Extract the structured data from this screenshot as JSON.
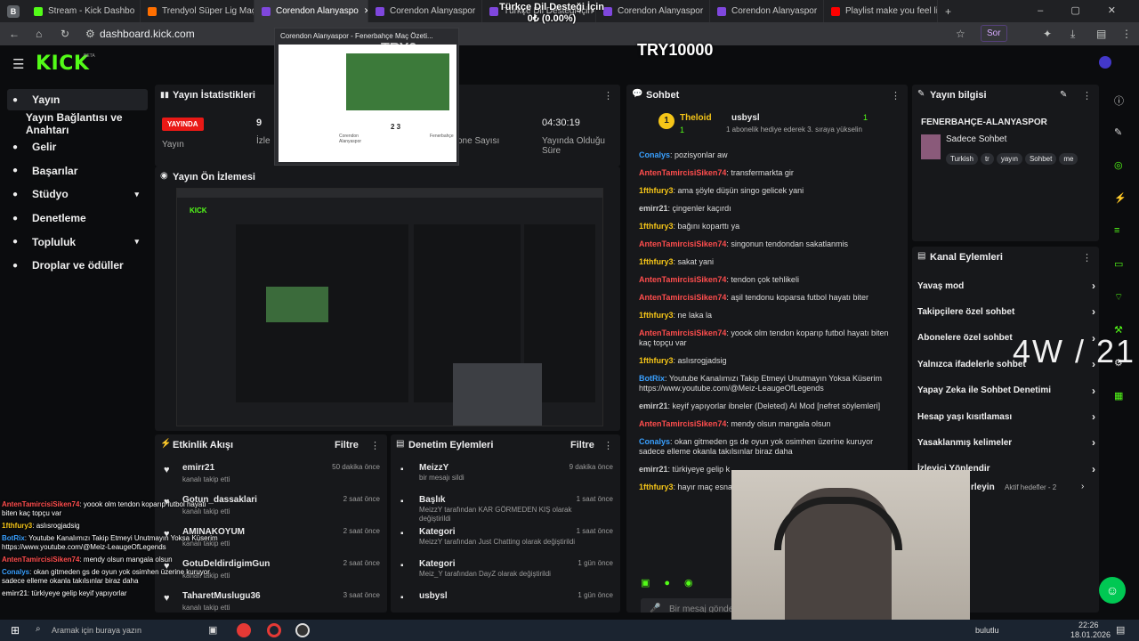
{
  "browser": {
    "tabs": [
      {
        "label": "Stream - Kick Dashbo",
        "color": "#53fc18",
        "active": false
      },
      {
        "label": "Trendyol Süper Lig Maç",
        "color": "#ff6f00",
        "active": false
      },
      {
        "label": "Corendon Alanyaspo",
        "color": "#7f47dd",
        "active": true
      },
      {
        "label": "Corendon Alanyaspor",
        "color": "#7f47dd",
        "active": false
      },
      {
        "label": "Türkçe Dil Desteği İçin",
        "color": "#7f47dd",
        "active": false
      },
      {
        "label": "Corendon Alanyaspor",
        "color": "#7f47dd",
        "active": false
      },
      {
        "label": "Corendon Alanyaspor",
        "color": "#7f47dd",
        "active": false
      },
      {
        "label": "Playlist make you feel lik",
        "color": "#ff0000",
        "active": false
      }
    ],
    "url": "dashboard.kick.com",
    "sor_label": "Sor"
  },
  "tab_preview": {
    "title": "Corendon Alanyaspor - Fenerbahçe Maç Özeti...",
    "score": "2 3",
    "team_left": "Corendon Alanyaspor",
    "team_right": "Fenerbahçe"
  },
  "overlay": {
    "goal_title": "Türkçe Dil Desteği İçin",
    "goal_value": "0₺ (0.00%)",
    "try0": "TRY0",
    "try10000": "TRY10000",
    "side_counter": "4W / 21"
  },
  "kick": {
    "logo": "KICK",
    "beta": "BETA",
    "sidebar": [
      {
        "label": "Yayın",
        "icon": "signal-icon",
        "active": true,
        "expand": false
      },
      {
        "label": "Yayın Bağlantısı ve Anahtarı",
        "icon": "",
        "active": false,
        "expand": false
      },
      {
        "label": "Gelir",
        "icon": "dollar-icon",
        "active": false,
        "expand": false
      },
      {
        "label": "Başarılar",
        "icon": "trophy-icon",
        "active": false,
        "expand": false
      },
      {
        "label": "Stüdyo",
        "icon": "video-icon",
        "active": false,
        "expand": true
      },
      {
        "label": "Denetleme",
        "icon": "wrench-icon",
        "active": false,
        "expand": false
      },
      {
        "label": "Topluluk",
        "icon": "users-icon",
        "active": false,
        "expand": true
      },
      {
        "label": "Droplar ve ödüller",
        "icon": "gift-icon",
        "active": false,
        "expand": false
      }
    ],
    "stats": {
      "title": "Yayın İstatistikleri",
      "live_badge": "YAYINDA",
      "live_sub": "Yayın",
      "viewers_value": "9",
      "viewers_label": "İzle",
      "subs_label": "one Sayısı",
      "uptime_value": "04:30:19",
      "uptime_label": "Yayında Olduğu Süre"
    },
    "preview_title": "Yayın Ön İzlemesi",
    "activity": {
      "title": "Etkinlik Akışı",
      "filter": "Filtre",
      "items": [
        {
          "name": "emirr21",
          "desc": "kanalı takip etti",
          "time": "50 dakika önce"
        },
        {
          "name": "Gotun_dassaklari",
          "desc": "kanalı takip etti",
          "time": "2 saat önce"
        },
        {
          "name": "AMINAKOYUM",
          "desc": "kanalı takip etti",
          "time": "2 saat önce"
        },
        {
          "name": "GotuDeldirdigimGun",
          "desc": "kanalı takip etti",
          "time": "2 saat önce"
        },
        {
          "name": "TaharetMuslugu36",
          "desc": "kanalı takip etti",
          "time": "3 saat önce"
        }
      ]
    },
    "moderation": {
      "title": "Denetim Eylemleri",
      "filter": "Filtre",
      "items": [
        {
          "icon": "trash-icon",
          "name": "MeizzY",
          "desc": "bir mesajı sildi",
          "time": "9 dakika önce"
        },
        {
          "icon": "title-icon",
          "name": "Başlık",
          "desc": "MeizzY tarafından KAR GÖRMEDEN KIŞ olarak değiştirildi",
          "time": "1 saat önce"
        },
        {
          "icon": "category-icon",
          "name": "Kategori",
          "desc": "MeizzY tarafından Just Chatting olarak değiştirildi",
          "time": "1 saat önce"
        },
        {
          "icon": "category-icon",
          "name": "Kategori",
          "desc": "Meiz_Y tarafından DayZ olarak değiştirildi",
          "time": "1 gün önce"
        },
        {
          "icon": "user-icon",
          "name": "usbysl",
          "desc": "",
          "time": "1 gün önce"
        }
      ]
    },
    "chat": {
      "title": "Sohbet",
      "pinned_user1": "Theloid",
      "pinned_count1": "1",
      "pinned_user2": "usbysl",
      "pinned_count2": "1",
      "pinned_note": "1 abonelik hediye ederek 3. sıraya yükselin",
      "messages": [
        {
          "user": "Conalys",
          "color": "u-blue",
          "text": "pozisyonlar aw"
        },
        {
          "user": "AntenTamircisiSiken74",
          "color": "u-red",
          "text": "transfermarkta gir"
        },
        {
          "user": "1fthfury3",
          "color": "u-yel",
          "text": "ama şöyle düşün singo gelicek yani"
        },
        {
          "user": "emirr21",
          "color": "u-gray",
          "text": "çingenler kaçırdı"
        },
        {
          "user": "1fthfury3",
          "color": "u-yel",
          "text": "bağını koparttı ya"
        },
        {
          "user": "AntenTamircisiSiken74",
          "color": "u-red",
          "text": "singonun tendondan sakatlanmis"
        },
        {
          "user": "1fthfury3",
          "color": "u-yel",
          "text": "sakat yani"
        },
        {
          "user": "AntenTamircisiSiken74",
          "color": "u-red",
          "text": "tendon çok tehlikeli"
        },
        {
          "user": "AntenTamircisiSiken74",
          "color": "u-red",
          "text": "aşil tendonu koparsa futbol hayatı biter"
        },
        {
          "user": "1fthfury3",
          "color": "u-yel",
          "text": "ne laka la"
        },
        {
          "user": "AntenTamircisiSiken74",
          "color": "u-red",
          "text": "yoook olm tendon koparıp futbol hayatı biten kaç topçu var"
        },
        {
          "user": "1fthfury3",
          "color": "u-yel",
          "text": "aslısrogjadsig"
        },
        {
          "user": "BotRix",
          "color": "u-blue",
          "text": "Youtube Kanalımızı Takip Etmeyi Unutmayın Yoksa Küserim https://www.youtube.com/@Meiz-LeaugeOfLegends"
        },
        {
          "user": "emirr21",
          "color": "u-gray",
          "text": "keyif yapıyorlar ibneler (Deleted) AI Mod [nefret söylemleri]"
        },
        {
          "user": "AntenTamircisiSiken74",
          "color": "u-red",
          "text": "mendy olsun mangala olsun"
        },
        {
          "user": "Conalys",
          "color": "u-blue",
          "text": "okan gitmeden gs de oyun yok osimhen üzerine kuruyor sadece elleme okanla takılsınlar biraz daha"
        },
        {
          "user": "emirr21",
          "color": "u-gray",
          "text": "türkiyeye gelip k"
        },
        {
          "user": "1fthfury3",
          "color": "u-yel",
          "text": "hayır maç esna"
        }
      ],
      "input_placeholder": "Bir mesaj gönder",
      "points": "0"
    },
    "info": {
      "title": "Yayın bilgisi",
      "stream_title": "FENERBAHÇE-ALANYASPOR",
      "category": "Sadece Sohbet",
      "tags": [
        "Turkish",
        "tr",
        "yayın",
        "Sohbet",
        "me"
      ]
    },
    "channel_actions": {
      "title": "Kanal Eylemleri",
      "items": [
        "Yavaş mod",
        "Takipçilere özel sohbet",
        "Abonelere özel sohbet",
        "Yalnızca ifadelerle sohbet",
        "Yapay Zeka ile Sohbet Denetimi",
        "Hesap yaşı kısıtlaması",
        "Yasaklanmış kelimeler",
        "İzleyici Yönlendir"
      ],
      "goals_label": "Aktif hedefler - 2",
      "goals_prefix": "rleyin"
    }
  },
  "overlay_chat": [
    {
      "user": "AntenTamircisiSiken74",
      "color": "u-red",
      "text": "yoook olm tendon koparıp futbol hayatı biten kaç topçu var"
    },
    {
      "user": "1fthfury3",
      "color": "u-yel",
      "text": "aslısrogjadsig"
    },
    {
      "user": "BotRix",
      "color": "u-blue",
      "text": "Youtube Kanalımızı Takip Etmeyi Unutmayın Yoksa Küserim https://www.youtube.com/@Meiz-LeaugeOfLegends"
    },
    {
      "user": "AntenTamircisiSiken74",
      "color": "u-red",
      "text": "mendy olsun mangala olsun"
    },
    {
      "user": "Conalys",
      "color": "u-blue",
      "text": "okan gitmeden gs de oyun yok osimhen üzerine kuruyor sadece elleme okanla takılsınlar biraz daha"
    },
    {
      "user": "emirr21",
      "color": "u-gray",
      "text": "türkiyeye gelip keyif yapıyorlar"
    }
  ],
  "taskbar": {
    "search": "Aramak için buraya yazın",
    "network": "bulutlu",
    "time": "22:26",
    "date": "18.01.2026"
  }
}
